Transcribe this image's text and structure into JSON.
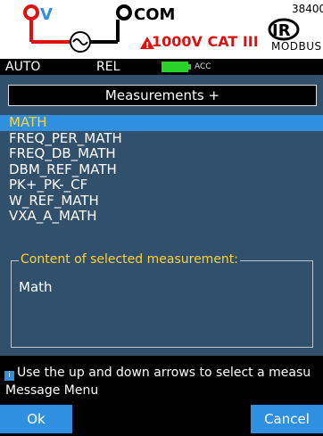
{
  "banner": {
    "terminal_v": "V",
    "terminal_com": "COM",
    "warning": "1000V CAT III",
    "ir": "IR",
    "modbus": "MODBUS",
    "serial": "38400"
  },
  "status": {
    "mode": "AUTO",
    "rel": "REL",
    "acc": "ACC"
  },
  "dialog": {
    "title": "Measurements +",
    "items": [
      {
        "label": "MATH"
      },
      {
        "label": "FREQ_PER_MATH"
      },
      {
        "label": "FREQ_DB_MATH"
      },
      {
        "label": "DBM_REF_MATH"
      },
      {
        "label": "PK+_PK-_CF"
      },
      {
        "label": "W_REF_MATH"
      },
      {
        "label": "VXA_A_MATH"
      }
    ],
    "selected_index": 0,
    "content_legend": "Content of selected measurement:",
    "content_value": "Math"
  },
  "footer": {
    "info": "Use the up and down arrows to select a measu",
    "menu_label": "Message Menu",
    "ok_label": "Ok",
    "cancel_label": "Cancel"
  },
  "colors": {
    "panel": "#30506c",
    "accent": "#2f8fe0",
    "highlight_text": "#ffd23a",
    "warning_red": "#e01010",
    "battery_green": "#2cd22c"
  }
}
